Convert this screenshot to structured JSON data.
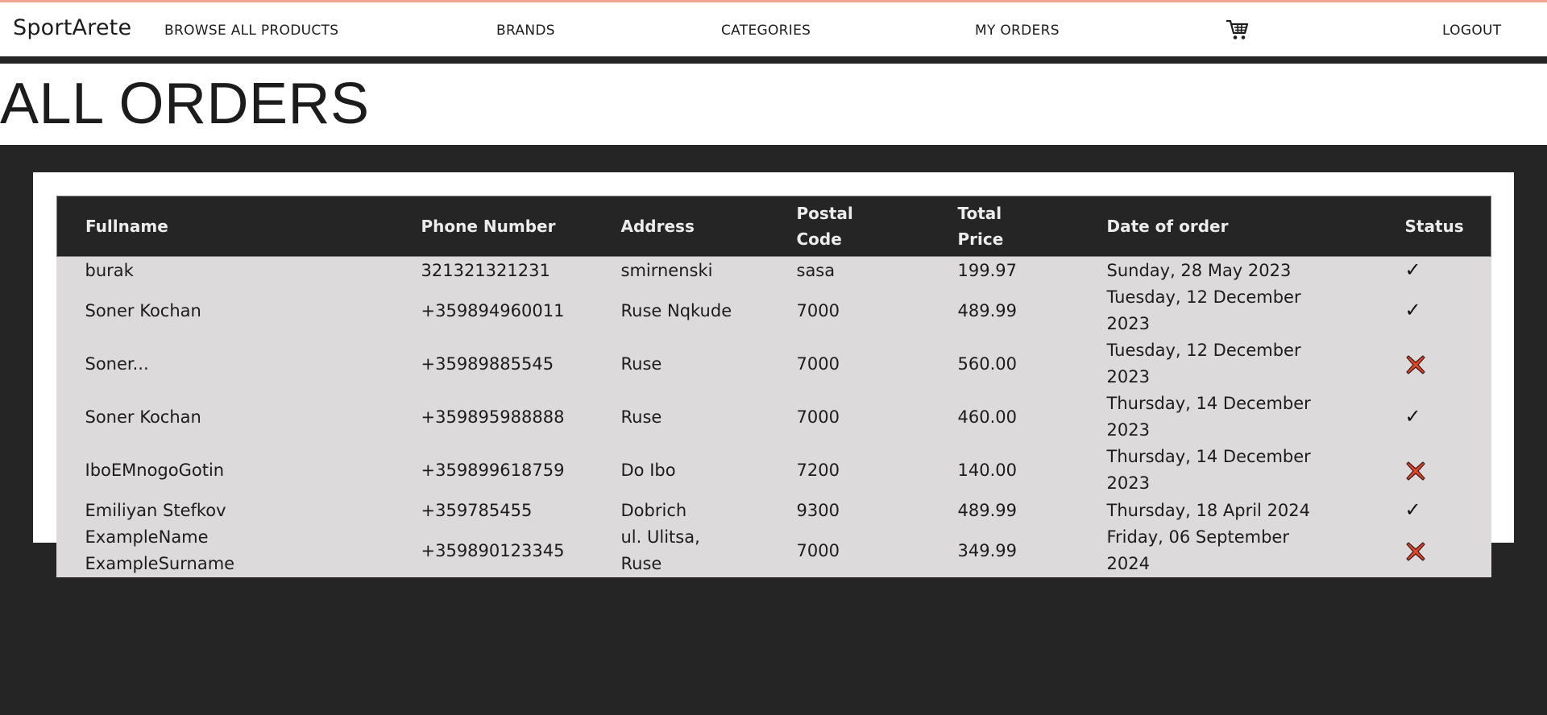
{
  "nav": {
    "brand": "SportArete",
    "links": [
      "BROWSE ALL PRODUCTS",
      "BRANDS",
      "CATEGORIES",
      "MY ORDERS"
    ],
    "cart_icon": "shopping-cart-icon",
    "logout": "LOGOUT"
  },
  "page": {
    "title": "ALL ORDERS"
  },
  "table": {
    "headers": [
      "Fullname",
      "Phone Number",
      "Address",
      "Postal Code",
      "Total Price",
      "Date of order",
      "Status"
    ],
    "rows": [
      {
        "fullname": "burak",
        "phone": "321321321231",
        "address": "smirnenski",
        "postal": "sasa",
        "price": "199.97",
        "date": "Sunday, 28 May 2023",
        "status": "completed"
      },
      {
        "fullname": "Soner Kochan",
        "phone": "+359894960011",
        "address": "Ruse Nqkude",
        "postal": "7000",
        "price": "489.99",
        "date": "Tuesday, 12 December 2023",
        "status": "completed"
      },
      {
        "fullname": "Soner...",
        "phone": "+35989885545",
        "address": "Ruse",
        "postal": "7000",
        "price": "560.00",
        "date": "Tuesday, 12 December 2023",
        "status": "cancelled"
      },
      {
        "fullname": "Soner Kochan",
        "phone": "+359895988888",
        "address": "Ruse",
        "postal": "7000",
        "price": "460.00",
        "date": "Thursday, 14 December 2023",
        "status": "completed"
      },
      {
        "fullname": "IboEMnogoGotin",
        "phone": "+359899618759",
        "address": "Do Ibo",
        "postal": "7200",
        "price": "140.00",
        "date": "Thursday, 14 December 2023",
        "status": "cancelled"
      },
      {
        "fullname": "Emiliyan Stefkov",
        "phone": "+359785455",
        "address": "Dobrich",
        "postal": "9300",
        "price": "489.99",
        "date": "Thursday, 18 April 2024",
        "status": "completed"
      },
      {
        "fullname": "ExampleName ExampleSurname",
        "phone": "+359890123345",
        "address": "ul. Ulitsa, Ruse",
        "postal": "7000",
        "price": "349.99",
        "date": "Friday, 06 September 2024",
        "status": "cancelled"
      }
    ],
    "status_icons": {
      "completed": "checkmark-icon",
      "cancelled": "red-x-icon"
    },
    "colors": {
      "header_bg": "#252525",
      "row_bg": "#dcdadb",
      "cancel_red": "#e2452a",
      "accent_line": "#f0a58e"
    }
  }
}
